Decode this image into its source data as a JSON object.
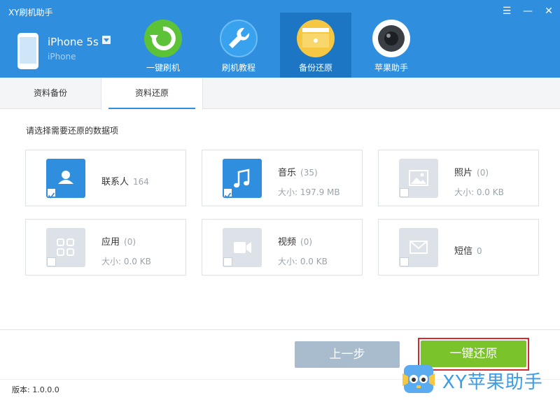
{
  "app": {
    "title": "XY刷机助手"
  },
  "window_controls": [
    "☰",
    "—",
    "✕"
  ],
  "device": {
    "name": "iPhone 5s",
    "type": "iPhone"
  },
  "nav": [
    {
      "label": "一键刷机",
      "icon": "refresh-icon",
      "color": "#5cc338"
    },
    {
      "label": "刷机教程",
      "icon": "wrench-icon",
      "color": "#39a2ee"
    },
    {
      "label": "备份还原",
      "icon": "folder-icon",
      "color": "#f5c742",
      "active": true
    },
    {
      "label": "苹果助手",
      "icon": "camera-icon",
      "color": "#ffffff"
    }
  ],
  "tabs": [
    {
      "label": "资料备份",
      "active": false
    },
    {
      "label": "资料还原",
      "active": true
    }
  ],
  "instruction": "请选择需要还原的数据项",
  "items": [
    {
      "name": "联系人",
      "count": "164",
      "size": "",
      "checked": true,
      "icon": "contact-icon"
    },
    {
      "name": "音乐",
      "count": "(35)",
      "size": "大小: 197.9 MB",
      "checked": true,
      "icon": "music-icon"
    },
    {
      "name": "照片",
      "count": "(0)",
      "size": "大小: 0.0 KB",
      "checked": false,
      "icon": "photo-icon"
    },
    {
      "name": "应用",
      "count": "(0)",
      "size": "大小: 0.0 KB",
      "checked": false,
      "icon": "apps-icon"
    },
    {
      "name": "视频",
      "count": "(0)",
      "size": "大小: 0.0 KB",
      "checked": false,
      "icon": "video-icon"
    },
    {
      "name": "短信",
      "count": "0",
      "size": "",
      "checked": false,
      "icon": "sms-icon"
    }
  ],
  "buttons": {
    "prev": "上一步",
    "restore": "一键还原"
  },
  "footer": {
    "version": "版本: 1.0.0.0",
    "brand": "XY苹果助手"
  },
  "colors": {
    "header": "#2f8fde",
    "header_active": "#1d76c4",
    "restore_button": "#7bc32a",
    "prev_button": "#a9bccd",
    "highlight_frame": "#d32b2b"
  }
}
